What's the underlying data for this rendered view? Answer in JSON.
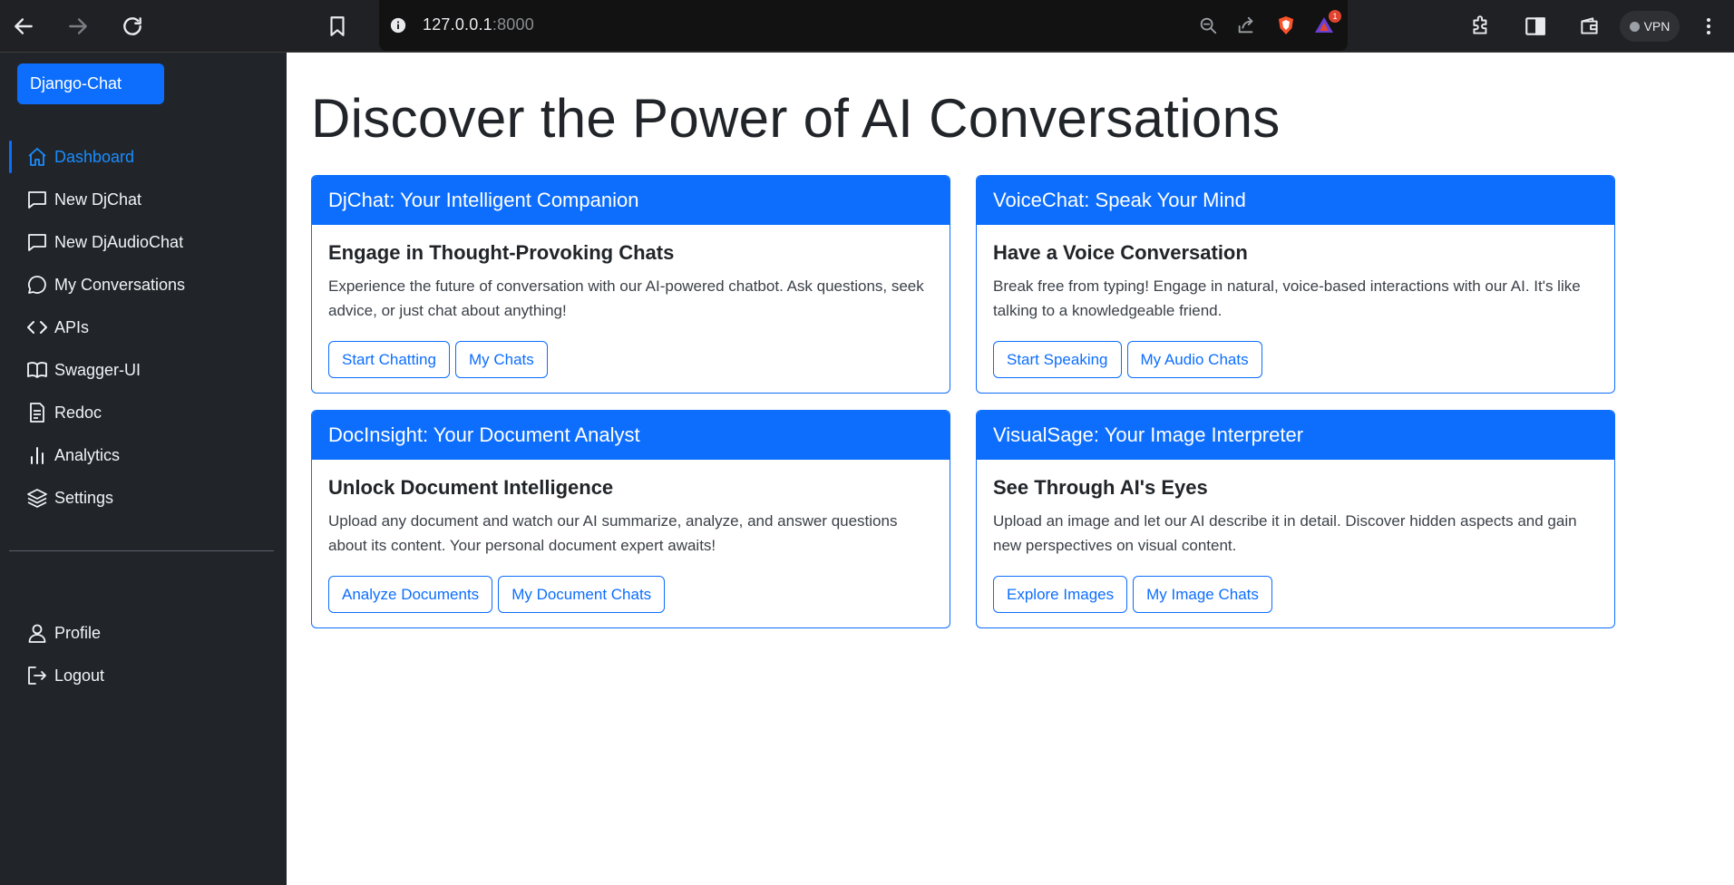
{
  "browser": {
    "url_host": "127.0.0.1",
    "url_port": ":8000",
    "vpn_label": "VPN",
    "notification_count": "1",
    "icons": [
      "back-icon",
      "forward-icon",
      "reload-icon",
      "bookmark-icon",
      "info-icon",
      "zoom-out-icon",
      "share-icon",
      "brave-shield-icon",
      "brave-rewards-icon",
      "extensions-icon",
      "sidebar-panel-icon",
      "wallet-icon",
      "menu-dots-icon"
    ]
  },
  "sidebar": {
    "brand": "Django-Chat",
    "items": [
      {
        "label": "Dashboard",
        "icon": "house-icon",
        "active": true
      },
      {
        "label": "New DjChat",
        "icon": "chat-square-icon"
      },
      {
        "label": "New DjAudioChat",
        "icon": "chat-square-icon"
      },
      {
        "label": "My Conversations",
        "icon": "chat-bubble-icon"
      },
      {
        "label": "APIs",
        "icon": "code-icon"
      },
      {
        "label": "Swagger-UI",
        "icon": "book-icon"
      },
      {
        "label": "Redoc",
        "icon": "file-text-icon"
      },
      {
        "label": "Analytics",
        "icon": "bar-chart-icon"
      },
      {
        "label": "Settings",
        "icon": "layers-icon"
      }
    ],
    "bottom_items": [
      {
        "label": "Profile",
        "icon": "person-icon"
      },
      {
        "label": "Logout",
        "icon": "box-arrow-right-icon"
      }
    ]
  },
  "main": {
    "title": "Discover the Power of AI Conversations",
    "cards": [
      {
        "header": "DjChat: Your Intelligent Companion",
        "title": "Engage in Thought-Provoking Chats",
        "text": "Experience the future of conversation with our AI-powered chatbot. Ask questions, seek advice, or just chat about anything!",
        "buttons": [
          "Start Chatting",
          "My Chats"
        ]
      },
      {
        "header": "VoiceChat: Speak Your Mind",
        "title": "Have a Voice Conversation",
        "text": "Break free from typing! Engage in natural, voice-based interactions with our AI. It's like talking to a knowledgeable friend.",
        "buttons": [
          "Start Speaking",
          "My Audio Chats"
        ]
      },
      {
        "header": "DocInsight: Your Document Analyst",
        "title": "Unlock Document Intelligence",
        "text": "Upload any document and watch our AI summarize, analyze, and answer questions about its content. Your personal document expert awaits!",
        "buttons": [
          "Analyze Documents",
          "My Document Chats"
        ]
      },
      {
        "header": "VisualSage: Your Image Interpreter",
        "title": "See Through AI's Eyes",
        "text": "Upload an image and let our AI describe it in detail. Discover hidden aspects and gain new perspectives on visual content.",
        "buttons": [
          "Explore Images",
          "My Image Chats"
        ]
      }
    ]
  },
  "colors": {
    "primary": "#0d6efd",
    "sidebar_bg": "#212529",
    "active_link": "#1a8cff",
    "chrome_bg": "#202124"
  }
}
